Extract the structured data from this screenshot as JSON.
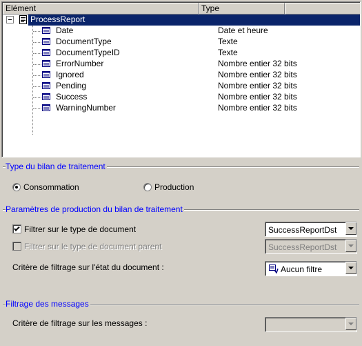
{
  "tree": {
    "columns": [
      "Elément",
      "Type",
      ""
    ],
    "root": "ProcessReport",
    "rows": [
      {
        "name": "Date",
        "type": "Date et heure"
      },
      {
        "name": "DocumentType",
        "type": "Texte"
      },
      {
        "name": "DocumentTypeID",
        "type": "Texte"
      },
      {
        "name": "ErrorNumber",
        "type": "Nombre entier 32 bits"
      },
      {
        "name": "Ignored",
        "type": "Nombre entier 32 bits"
      },
      {
        "name": "Pending",
        "type": "Nombre entier 32 bits"
      },
      {
        "name": "Success",
        "type": "Nombre entier 32 bits"
      },
      {
        "name": "WarningNumber",
        "type": "Nombre entier 32 bits"
      }
    ]
  },
  "type_group": {
    "title": "Type du bilan de traitement",
    "consommation": "Consommation",
    "production": "Production",
    "selected": "Consommation"
  },
  "params_group": {
    "title": "Paramètres de production du bilan de traitement",
    "filter_doc_type": "Filtrer sur le type de document",
    "filter_doc_type_checked": true,
    "filter_doc_type_value": "SuccessReportDst",
    "filter_parent_type": "Filtrer sur le type de document parent",
    "filter_parent_type_checked": false,
    "filter_parent_type_value": "SuccessReportDst",
    "state_criteria": "Critère de filtrage sur l'état du document :",
    "state_criteria_value": "Aucun filtre"
  },
  "messages_group": {
    "title": "Filtrage des messages",
    "criteria": "Critère de filtrage sur les messages :",
    "criteria_value": ""
  },
  "colors": {
    "selection": "#0a246a",
    "group_title": "#0000ff",
    "face": "#d4d0c8"
  }
}
